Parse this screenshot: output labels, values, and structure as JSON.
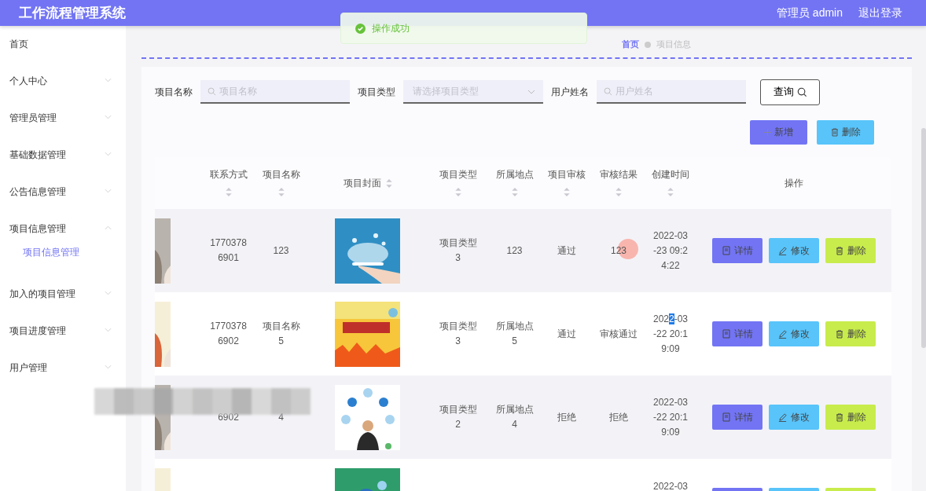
{
  "header": {
    "title": "工作流程管理系统",
    "user": "管理员 admin",
    "logout": "退出登录"
  },
  "toast": {
    "message": "操作成功"
  },
  "sidebar": {
    "items": [
      {
        "label": "首页",
        "has_children": false,
        "expanded": false
      },
      {
        "label": "个人中心",
        "has_children": true,
        "expanded": false
      },
      {
        "label": "管理员管理",
        "has_children": true,
        "expanded": false
      },
      {
        "label": "基础数据管理",
        "has_children": true,
        "expanded": false
      },
      {
        "label": "公告信息管理",
        "has_children": true,
        "expanded": false
      },
      {
        "label": "项目信息管理",
        "has_children": true,
        "expanded": true,
        "children": [
          {
            "label": "项目信息管理",
            "selected": true
          }
        ]
      },
      {
        "label": "加入的项目管理",
        "has_children": true,
        "expanded": false
      },
      {
        "label": "项目进度管理",
        "has_children": true,
        "expanded": false
      },
      {
        "label": "用户管理",
        "has_children": true,
        "expanded": false
      }
    ]
  },
  "breadcrumb": [
    "首页",
    "项目信息"
  ],
  "search": {
    "fields": [
      {
        "label": "项目名称",
        "kind": "input",
        "placeholder": "项目名称"
      },
      {
        "label": "项目类型",
        "kind": "select",
        "placeholder": "请选择项目类型"
      },
      {
        "label": "用户姓名",
        "kind": "input",
        "placeholder": "用户姓名"
      }
    ],
    "button": "查询"
  },
  "toolbar": [
    {
      "label": "新增",
      "kind": "add"
    },
    {
      "label": "删除",
      "kind": "delete"
    }
  ],
  "table": {
    "columns": [
      {
        "label": "联系方式",
        "sortable": true
      },
      {
        "label": "项目名称",
        "sortable": true
      },
      {
        "label": "项目封面",
        "sortable": true
      },
      {
        "label": "项目类型",
        "sortable": true
      },
      {
        "label": "所属地点",
        "sortable": true
      },
      {
        "label": "项目审核",
        "sortable": true
      },
      {
        "label": "审核结果",
        "sortable": true
      },
      {
        "label": "创建时间",
        "sortable": true
      },
      {
        "label": "操作",
        "sortable": false
      }
    ],
    "rows": [
      {
        "cells": [
          {
            "text": "1770378\n6901"
          },
          {
            "text": "123"
          },
          {
            "kind": "picture"
          },
          {
            "text": "项目类型\n3"
          },
          {
            "text": "123"
          },
          {
            "text": "通过"
          },
          {
            "text": "123",
            "clicked": true
          },
          {
            "text": "2022-03\n-23 09:2\n4:22"
          }
        ],
        "redacted": false,
        "actions": [
          {
            "label": "详情",
            "kind": "detail"
          },
          {
            "label": "修改",
            "kind": "edit"
          },
          {
            "label": "删除",
            "kind": "delete"
          }
        ]
      },
      {
        "cells": [
          {
            "text": "1770378\n6902"
          },
          {
            "text": "项目名称\n5"
          },
          {
            "kind": "picture"
          },
          {
            "text": "项目类型\n3"
          },
          {
            "text": "所属地点\n5"
          },
          {
            "text": "通过"
          },
          {
            "text": "审核通过"
          },
          {
            "parts": [
              {
                "text": "202",
                "selected": false
              },
              {
                "text": "2",
                "selected": true
              },
              {
                "text": "-03\n-22 20:1\n9:09",
                "selected": false
              }
            ]
          }
        ],
        "redacted": false,
        "actions": [
          {
            "label": "详情",
            "kind": "detail"
          },
          {
            "label": "修改",
            "kind": "edit"
          },
          {
            "label": "删除",
            "kind": "delete"
          }
        ]
      },
      {
        "cells": [
          {
            "text": "6902"
          },
          {
            "text": "4"
          },
          {
            "kind": "picture"
          },
          {
            "text": "项目类型\n2"
          },
          {
            "text": "所属地点\n4"
          },
          {
            "text": "拒绝"
          },
          {
            "text": "拒绝"
          },
          {
            "text": "2022-03\n-22 20:1\n9:09"
          }
        ],
        "redacted": true,
        "actions": [
          {
            "label": "详情",
            "kind": "detail"
          },
          {
            "label": "修改",
            "kind": "edit"
          },
          {
            "label": "删除",
            "kind": "delete"
          }
        ]
      },
      {
        "cells": [
          {
            "text": ""
          },
          {
            "text": ""
          },
          {
            "kind": "picture"
          },
          {
            "text": ""
          },
          {
            "text": ""
          },
          {
            "text": ""
          },
          {
            "text": ""
          },
          {
            "text": "2022-03",
            "cut": true
          }
        ],
        "redacted": false,
        "actions": [
          {
            "kind": "detail"
          },
          {
            "kind": "edit"
          },
          {
            "kind": "delete"
          }
        ]
      }
    ]
  }
}
